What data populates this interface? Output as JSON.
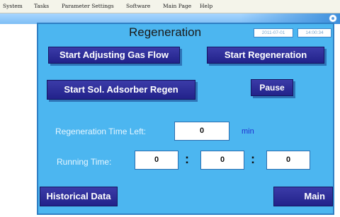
{
  "menubar": {
    "items": [
      {
        "label": "System"
      },
      {
        "label": "Tasks"
      },
      {
        "label": "Parameter Settings"
      },
      {
        "label": "Software"
      },
      {
        "label": "Main Page"
      },
      {
        "label": "Help"
      }
    ]
  },
  "header": {
    "title": "Regeneration",
    "date": "2011-07-01",
    "time": "14:00:34"
  },
  "buttons": {
    "start_adjusting_gas_flow": "Start Adjusting Gas Flow",
    "start_regeneration": "Start Regeneration",
    "start_sol_adsorber_regen": "Start Sol. Adsorber Regen",
    "pause": "Pause",
    "historical_data": "Historical Data",
    "main": "Main"
  },
  "regen_time_left": {
    "label": "Regeneration Time Left:",
    "value": "0",
    "unit": "min"
  },
  "running_time": {
    "label": "Running Time:",
    "hours": "0",
    "minutes": "0",
    "seconds": "0",
    "separator": ":"
  },
  "colors": {
    "panel_background": "#4cb6f0",
    "button_background": "#22228a",
    "unit_text": "#1f2fd0"
  }
}
